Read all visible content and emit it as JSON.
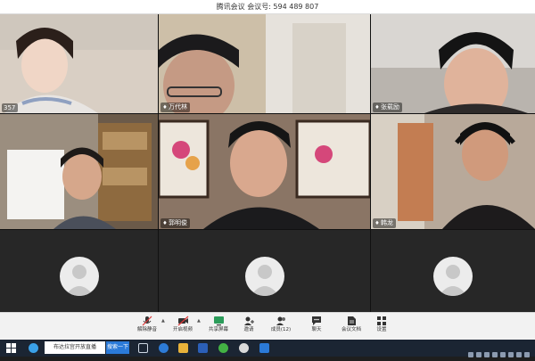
{
  "window": {
    "title": "腾讯会议 会议号: 594 489 807"
  },
  "participants": [
    {
      "name": "357",
      "label_prefix": "",
      "has_video": true,
      "palette": "#d9cfc4"
    },
    {
      "name": "万代林",
      "label_prefix": "mic",
      "has_video": true,
      "palette": "#cdbfa8"
    },
    {
      "name": "张载励",
      "label_prefix": "mic",
      "has_video": true,
      "palette": "#b9b4ae"
    },
    {
      "name": "",
      "label_prefix": "",
      "has_video": true,
      "palette": "#6b5a49"
    },
    {
      "name": "郭明俊",
      "label_prefix": "mic",
      "has_video": true,
      "palette": "#8a7565"
    },
    {
      "name": "韩龙",
      "label_prefix": "mic",
      "has_video": true,
      "palette": "#b8a99a"
    },
    {
      "name": "",
      "label_prefix": "",
      "has_video": false,
      "palette": "#272727"
    },
    {
      "name": "",
      "label_prefix": "",
      "has_video": false,
      "palette": "#272727"
    },
    {
      "name": "",
      "label_prefix": "",
      "has_video": false,
      "palette": "#272727"
    }
  ],
  "toolbar": {
    "mute": "解除静音",
    "video": "开启视频",
    "share": "共享屏幕",
    "invite": "邀请",
    "members": "成员(12)",
    "chat": "聊天",
    "docs": "会议文档",
    "settings": "设置"
  },
  "taskbar": {
    "search_text": "布达拉宫开放直播",
    "search_button": "搜索一下"
  },
  "colors": {
    "accent": "#2b7ad8",
    "toolbar_bg": "#f2f2f2",
    "grid_bg": "#111111"
  }
}
